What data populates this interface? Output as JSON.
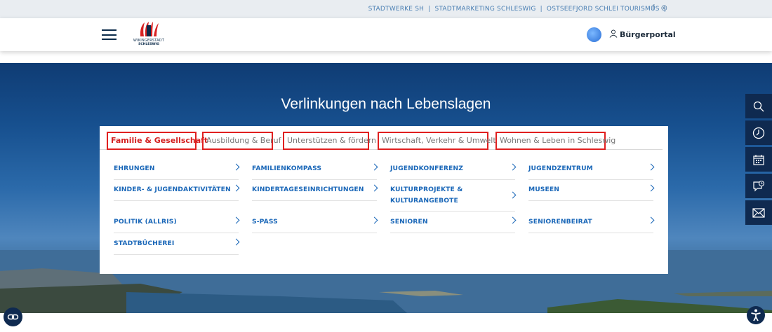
{
  "topbar": {
    "link1": "STADTWERKE SH",
    "sep": "|",
    "link2": "STADTMARKETING SCHLESWIG",
    "link3": "OSTSEEFJORD SCHLEI TOURISMUS",
    "facebook": "f",
    "instagram": "◎"
  },
  "header": {
    "logo_line1": "WIKINGERSTADT",
    "logo_line2": "SCHLESWIG",
    "portal_label": "Bürgerportal"
  },
  "hero": {
    "title": "Verlinkungen nach Lebenslagen"
  },
  "tabs": [
    {
      "label": "Familie & Gesellschaft"
    },
    {
      "label": "Ausbildung & Beruf"
    },
    {
      "label": "Unterstützen & fördern"
    },
    {
      "label": "Wirtschaft, Verkehr & Umwelt"
    },
    {
      "label": "Wohnen & Leben in Schleswig"
    }
  ],
  "links": [
    {
      "label": "EHRUNGEN"
    },
    {
      "label": "FAMILIENKOMPASS"
    },
    {
      "label": "JUGENDKONFERENZ"
    },
    {
      "label": "JUGENDZENTRUM"
    },
    {
      "label": "KINDER- & JUGENDAKTIVITÄTEN"
    },
    {
      "label": "KINDERTAGESEINRICHTUNGEN"
    },
    {
      "label": "KULTURPROJEKTE & KULTURANGEBOTE"
    },
    {
      "label": "MUSEEN"
    },
    {
      "label": "POLITIK (ALLRIS)"
    },
    {
      "label": "S-PASS"
    },
    {
      "label": "SENIOREN"
    },
    {
      "label": "SENIORENBEIRAT"
    },
    {
      "label": "STADTBÜCHEREI"
    }
  ],
  "colors": {
    "accent": "#d42121",
    "link": "#1a67b8",
    "navy": "#0f2a50"
  }
}
